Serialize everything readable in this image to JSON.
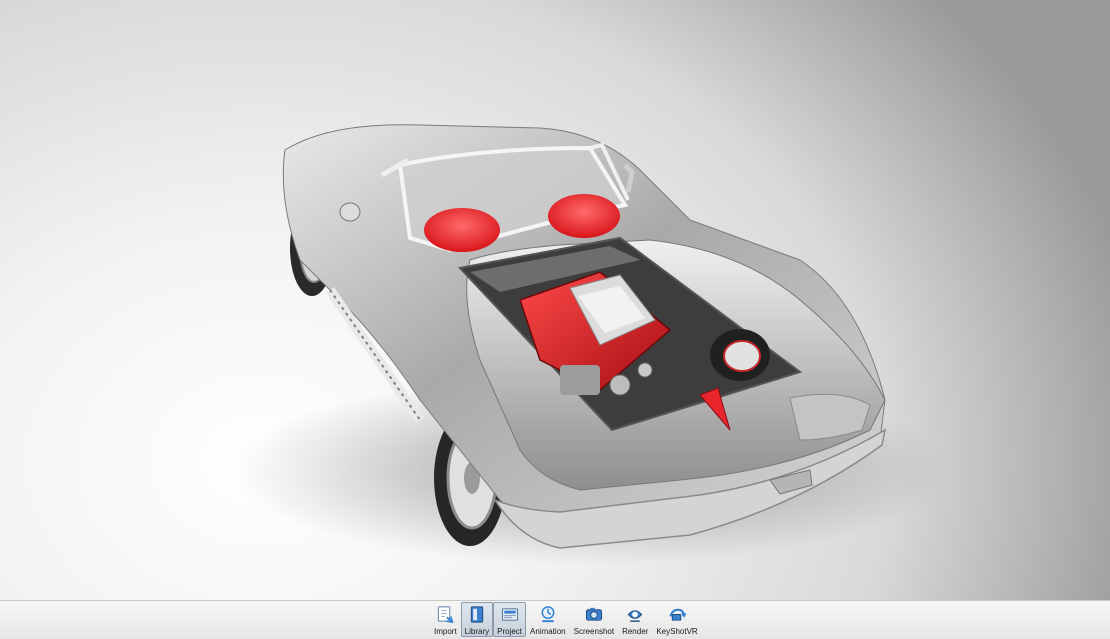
{
  "toolbar": {
    "items": [
      {
        "label": "Import",
        "icon": "import-icon",
        "active": false
      },
      {
        "label": "Library",
        "icon": "library-icon",
        "active": true
      },
      {
        "label": "Project",
        "icon": "project-icon",
        "active": true
      },
      {
        "label": "Animation",
        "icon": "animation-icon",
        "active": false
      },
      {
        "label": "Screenshot",
        "icon": "screenshot-icon",
        "active": false
      },
      {
        "label": "Render",
        "icon": "render-icon",
        "active": false
      },
      {
        "label": "KeyShotVR",
        "icon": "keyshotvr-icon",
        "active": false
      }
    ]
  },
  "colors": {
    "accent_red": "#e8262b",
    "body_silver": "#b9b9b9",
    "toolbar_icon_blue": "#2f7fd1"
  }
}
